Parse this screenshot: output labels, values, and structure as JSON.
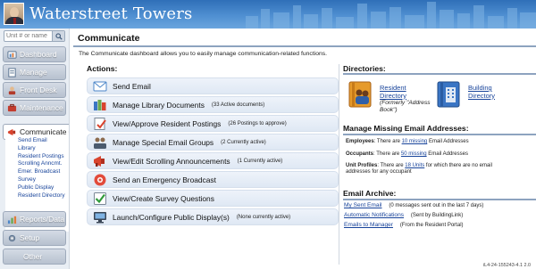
{
  "app": {
    "title": "Waterstreet Towers"
  },
  "search": {
    "placeholder": "Unit # or name"
  },
  "sidebar": {
    "items": [
      {
        "label": "Dashboard",
        "icon": "dashboard-icon"
      },
      {
        "label": "Manage",
        "icon": "manage-icon"
      },
      {
        "label": "Front Desk",
        "icon": "front-desk-icon"
      },
      {
        "label": "Maintenance",
        "icon": "maintenance-icon"
      },
      {
        "label": "Communicate",
        "icon": "communicate-icon",
        "active": true
      },
      {
        "label": "Reports/Data",
        "icon": "reports-icon"
      },
      {
        "label": "Setup",
        "icon": "setup-icon"
      },
      {
        "label": "Other",
        "icon": ""
      }
    ],
    "subitems": [
      "Send Email",
      "Library",
      "Resident Postings",
      "Scrolling Anncmt.",
      "Emer. Broadcast",
      "Survey",
      "Public Display",
      "Resident Directory"
    ]
  },
  "main": {
    "title": "Communicate",
    "intro": "The Communicate dashboard allows you to easily manage communication-related functions."
  },
  "actions": {
    "heading": "Actions:",
    "items": [
      {
        "label": "Send Email",
        "note": "",
        "icon": "email-icon"
      },
      {
        "label": "Manage Library Documents",
        "note": "(33 Active documents)",
        "icon": "library-books-icon"
      },
      {
        "label": "View/Approve Resident Postings",
        "note": "(26 Postings to approve)",
        "icon": "postings-icon"
      },
      {
        "label": "Manage Special Email Groups",
        "note": "(2 Currently active)",
        "icon": "email-groups-icon"
      },
      {
        "label": "View/Edit Scrolling Announcements",
        "note": "(1 Currently active)",
        "icon": "megaphone-icon"
      },
      {
        "label": "Send an Emergency Broadcast",
        "note": "",
        "icon": "emergency-broadcast-icon"
      },
      {
        "label": "View/Create Survey Questions",
        "note": "",
        "icon": "survey-check-icon"
      },
      {
        "label": "Launch/Configure Public Display(s)",
        "note": "(None currently active)",
        "icon": "public-display-icon"
      }
    ]
  },
  "directories": {
    "heading": "Directories:",
    "resident": {
      "line1": "Resident",
      "line2": "Directory",
      "sub1": "(Formerly \"Address",
      "sub2": "Book\")"
    },
    "building": {
      "line1": "Building",
      "line2": "Directory"
    }
  },
  "missing_email": {
    "heading": "Manage Missing Email Addresses:",
    "employees_label": "Employees",
    "employees_pre": ": There are ",
    "employees_link": "10 missing",
    "employees_post": " Email Addresses",
    "occupants_label": "Occupants",
    "occupants_pre": ": There are ",
    "occupants_link": "50 missing",
    "occupants_post": " Email Addresses",
    "profiles_label": "Unit Profiles",
    "profiles_pre": ": There are ",
    "profiles_link": "18 Units",
    "profiles_post1": " for which there are no email",
    "profiles_post2": "addresses for any occupant"
  },
  "archive": {
    "heading": "Email Archive:",
    "items": [
      {
        "link": "My Sent Email",
        "note": "(0  messages sent out in the last 7 days)"
      },
      {
        "link": "Automatic Notifications",
        "note": "(Sent by BuildingLink)"
      },
      {
        "link": "Emails to Manager",
        "note": "(From the Resident Portal)"
      }
    ]
  },
  "footer": {
    "version": "iL4-24-155243-4.1 2.0"
  },
  "colors": {
    "header": "#3f80c6",
    "link": "#17439a",
    "action_bg": "#e6edf7",
    "rule": "#8da3bf"
  }
}
